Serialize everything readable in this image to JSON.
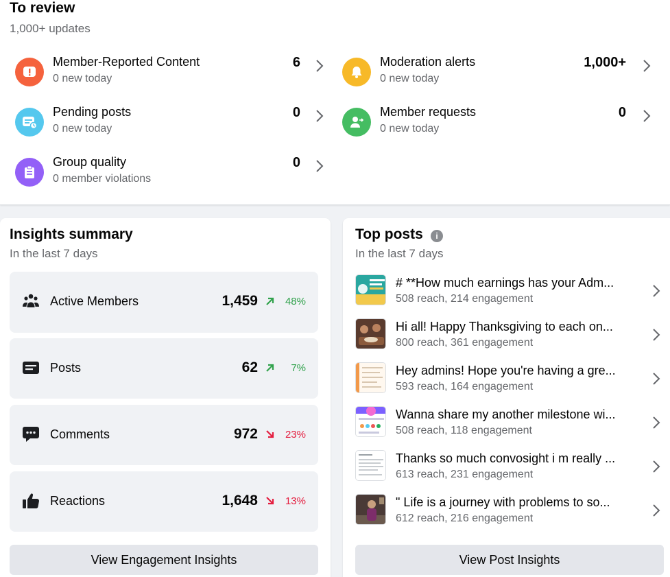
{
  "review": {
    "title": "To review",
    "subtitle": "1,000+ updates",
    "items": [
      {
        "label": "Member-Reported Content",
        "meta": "0 new today",
        "count": "6",
        "icon": "alert-icon",
        "color": "#f5623d"
      },
      {
        "label": "Moderation alerts",
        "meta": "0 new today",
        "count": "1,000+",
        "icon": "bell-icon",
        "color": "#f7b928"
      },
      {
        "label": "Pending posts",
        "meta": "0 new today",
        "count": "0",
        "icon": "pending-post-icon",
        "color": "#55c8ee"
      },
      {
        "label": "Member requests",
        "meta": "0 new today",
        "count": "0",
        "icon": "member-request-icon",
        "color": "#45bd62"
      },
      {
        "label": "Group quality",
        "meta": "0 member violations",
        "count": "0",
        "icon": "clipboard-icon",
        "color": "#9360f7"
      }
    ]
  },
  "insights": {
    "title": "Insights summary",
    "subtitle": "In the last 7 days",
    "stats": [
      {
        "label": "Active Members",
        "value": "1,459",
        "change": "48%",
        "direction": "up",
        "icon": "people-icon"
      },
      {
        "label": "Posts",
        "value": "62",
        "change": "7%",
        "direction": "up",
        "icon": "post-icon"
      },
      {
        "label": "Comments",
        "value": "972",
        "change": "23%",
        "direction": "down",
        "icon": "comment-icon"
      },
      {
        "label": "Reactions",
        "value": "1,648",
        "change": "13%",
        "direction": "down",
        "icon": "thumbs-up-icon"
      }
    ],
    "button": "View Engagement Insights"
  },
  "top_posts": {
    "title": "Top posts",
    "subtitle": "In the last 7 days",
    "posts": [
      {
        "title": "# **How much earnings has your Adm...",
        "meta": "508 reach, 214 engagement"
      },
      {
        "title": "Hi all! Happy Thanksgiving to each on...",
        "meta": "800 reach, 361 engagement"
      },
      {
        "title": "Hey admins! Hope you're having a gre...",
        "meta": "593 reach, 164 engagement"
      },
      {
        "title": "Wanna share my another milestone wi...",
        "meta": "508 reach, 118 engagement"
      },
      {
        "title": "Thanks so much convosight i m really ...",
        "meta": "613 reach, 231 engagement"
      },
      {
        "title": "\" Life is a journey with problems to so...",
        "meta": "612 reach, 216 engagement"
      }
    ],
    "button": "View Post Insights"
  },
  "colors": {
    "up": "#31a24c",
    "down": "#e41e3f",
    "background": "#f0f2f5"
  }
}
